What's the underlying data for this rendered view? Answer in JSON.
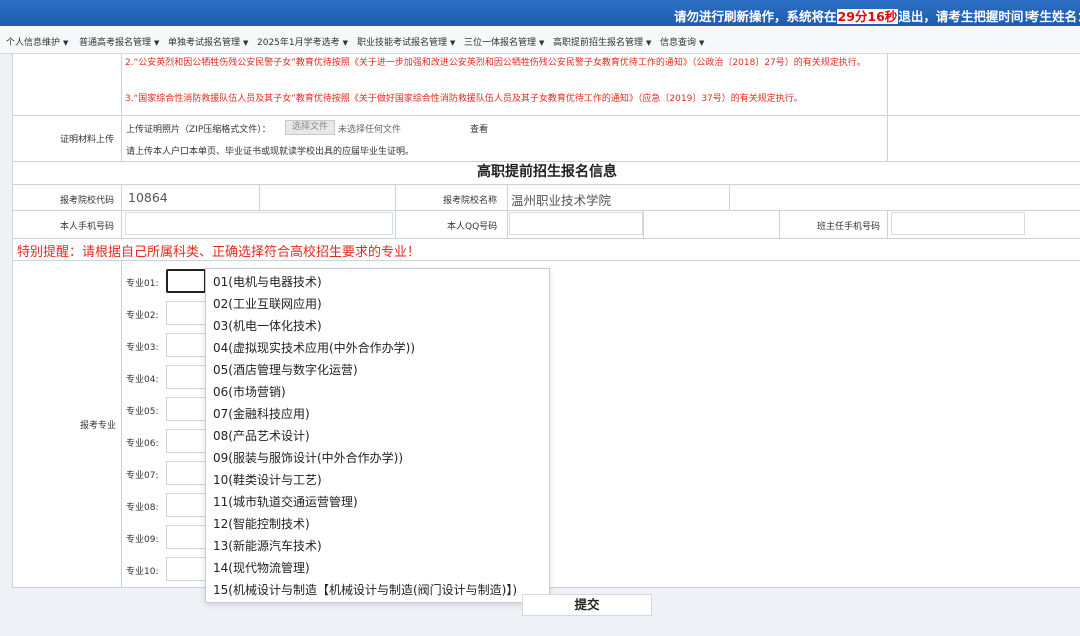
{
  "header": {
    "warning_prefix": "请勿进行刷新操作，系统将在",
    "timer": "29分16秒",
    "warning_suffix": "退出，请考生把握时间！",
    "examinee_label": "考生姓名："
  },
  "menu": [
    "个人信息维护",
    "普通高考报名管理",
    "单独考试报名管理",
    "2025年1月学考选考",
    "职业技能考试报名管理",
    "三位一体报名管理",
    "高职提前招生报名管理",
    "信息查询"
  ],
  "notices": {
    "item2": "2.“公安英烈和因公牺牲伤残公安民警子女”教育优待按照《关于进一步加强和改进公安英烈和因公牺牲伤残公安民警子女教育优待工作的通知》（公政治〔2018〕27号）的有关规定执行。",
    "item3": "3.“国家综合性消防救援队伍人员及其子女”教育优待按照《关于做好国家综合性消防救援队伍人员及其子女教育优待工作的通知》（应急〔2019〕37号）的有关规定执行。"
  },
  "proof": {
    "label": "证明材料上传",
    "upload_label": "上传证明照片（ZIP压缩格式文件）：",
    "file_button": "选择文件",
    "file_status": "未选择任何文件",
    "view_link": "查看",
    "hint": "请上传本人户口本单页、毕业证书或现就读学校出具的应届毕业生证明。"
  },
  "section_title": "高职提前招生报名信息",
  "school": {
    "code_label": "报考院校代码",
    "code_value": "10864",
    "name_label": "报考院校名称",
    "name_value": "温州职业技术学院"
  },
  "contact": {
    "phone_label": "本人手机号码",
    "qq_label": "本人QQ号码",
    "teacher_label": "班主任手机号码"
  },
  "special_reminder": "特别提醒：请根据自己所属科类、正确选择符合高校招生要求的专业！",
  "majors": {
    "section_label": "报考专业",
    "slots": [
      "专业01:",
      "专业02:",
      "专业03:",
      "专业04:",
      "专业05:",
      "专业06:",
      "专业07:",
      "专业08:",
      "专业09:",
      "专业10:"
    ],
    "options": [
      "01(电机与电器技术)",
      "02(工业互联网应用)",
      "03(机电一体化技术)",
      "04(虚拟现实技术应用(中外合作办学))",
      "05(酒店管理与数字化运营)",
      "06(市场营销)",
      "07(金融科技应用)",
      "08(产品艺术设计)",
      "09(服装与服饰设计(中外合作办学))",
      "10(鞋类设计与工艺)",
      "11(城市轨道交通运营管理)",
      "12(智能控制技术)",
      "13(新能源汽车技术)",
      "14(现代物流管理)",
      "15(机械设计与制造【机械设计与制造(阀门设计与制造)】)"
    ]
  },
  "submit_label": "提交"
}
